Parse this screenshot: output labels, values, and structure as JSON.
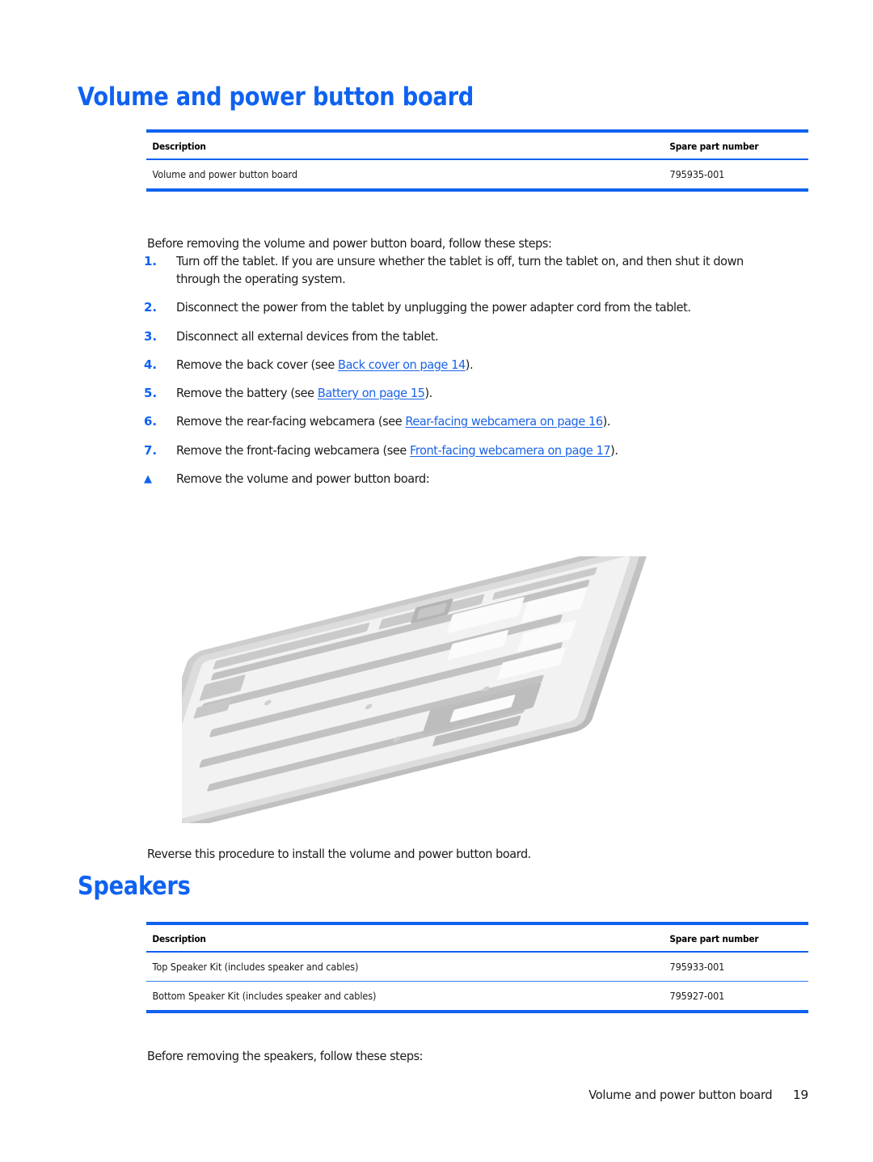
{
  "document": {
    "sections": [
      {
        "heading": "Volume and power button board",
        "table": {
          "headers": [
            "Description",
            "Spare part number"
          ],
          "rows": [
            [
              "Volume and power button board",
              "795935-001"
            ]
          ]
        },
        "intro": "Before removing the volume and power button board, follow these steps:",
        "steps": [
          {
            "marker": "1.",
            "parts": [
              {
                "type": "text",
                "value": "Turn off the tablet. If you are unsure whether the tablet is off, turn the tablet on, and then shut it down through the operating system."
              }
            ]
          },
          {
            "marker": "2.",
            "parts": [
              {
                "type": "text",
                "value": "Disconnect the power from the tablet by unplugging the power adapter cord from the tablet."
              }
            ]
          },
          {
            "marker": "3.",
            "parts": [
              {
                "type": "text",
                "value": "Disconnect all external devices from the tablet."
              }
            ]
          },
          {
            "marker": "4.",
            "parts": [
              {
                "type": "text",
                "value": "Remove the back cover (see "
              },
              {
                "type": "link",
                "value": "Back cover on page 14"
              },
              {
                "type": "text",
                "value": ")."
              }
            ]
          },
          {
            "marker": "5.",
            "parts": [
              {
                "type": "text",
                "value": "Remove the battery (see "
              },
              {
                "type": "link",
                "value": "Battery on page 15"
              },
              {
                "type": "text",
                "value": ")."
              }
            ]
          },
          {
            "marker": "6.",
            "parts": [
              {
                "type": "text",
                "value": "Remove the rear-facing webcamera (see "
              },
              {
                "type": "link",
                "value": "Rear-facing webcamera on page 16"
              },
              {
                "type": "text",
                "value": ")."
              }
            ]
          },
          {
            "marker": "7.",
            "parts": [
              {
                "type": "text",
                "value": "Remove the front-facing webcamera (see "
              },
              {
                "type": "link",
                "value": "Front-facing webcamera on page 17"
              },
              {
                "type": "text",
                "value": ")."
              }
            ]
          },
          {
            "marker": "▲",
            "marker_style": "triangle",
            "parts": [
              {
                "type": "text",
                "value": "Remove the volume and power button board:"
              }
            ]
          }
        ],
        "figure": {
          "name": "tablet-chassis-exploded-diagram",
          "description": "Tilted tablet back chassis with volume and power button board lifted away, indicated by an upward arrow"
        },
        "outro": "Reverse this procedure to install the volume and power button board."
      },
      {
        "heading": "Speakers",
        "table": {
          "headers": [
            "Description",
            "Spare part number"
          ],
          "rows": [
            [
              "Top Speaker Kit (includes speaker and cables)",
              "795933-001"
            ],
            [
              "Bottom Speaker Kit (includes speaker and cables)",
              "795927-001"
            ]
          ]
        },
        "intro": "Before removing the speakers, follow these steps:"
      }
    ]
  },
  "footer": {
    "title": "Volume and power button board",
    "page_number": "19"
  },
  "colors": {
    "heading_blue": "#0f62f0",
    "rule_blue": "#0f62f0",
    "link_blue": "#1a63e8",
    "body_text": "#1a1a1a",
    "page_background": "#ffffff"
  }
}
